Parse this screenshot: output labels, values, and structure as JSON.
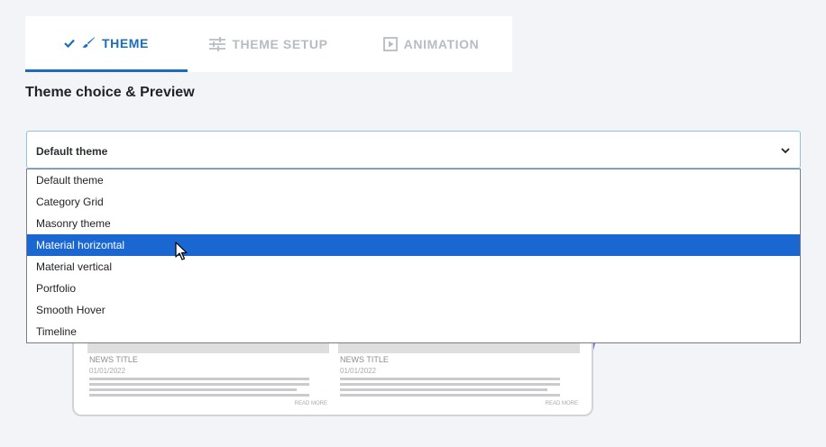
{
  "tabs": [
    {
      "label": "THEME",
      "icon": "brush-icon",
      "active": true
    },
    {
      "label": "THEME SETUP",
      "icon": "sliders-icon",
      "active": false
    },
    {
      "label": "ANIMATION",
      "icon": "play-icon",
      "active": false
    }
  ],
  "section_title": "Theme choice & Preview",
  "theme_select": {
    "value": "Default theme",
    "options": [
      "Default theme",
      "Category Grid",
      "Masonry theme",
      "Material horizontal",
      "Material vertical",
      "Portfolio",
      "Smooth Hover",
      "Timeline"
    ],
    "highlighted_index": 3
  },
  "preview": {
    "items": [
      {
        "title": "NEWS TITLE",
        "date": "01/01/2022",
        "more": "READ MORE"
      },
      {
        "title": "NEWS TITLE",
        "date": "01/01/2022",
        "more": "READ MORE"
      }
    ]
  },
  "colors": {
    "accent": "#1a6db8",
    "highlight": "#1a67d2",
    "ribbon": "#7b63e0"
  }
}
